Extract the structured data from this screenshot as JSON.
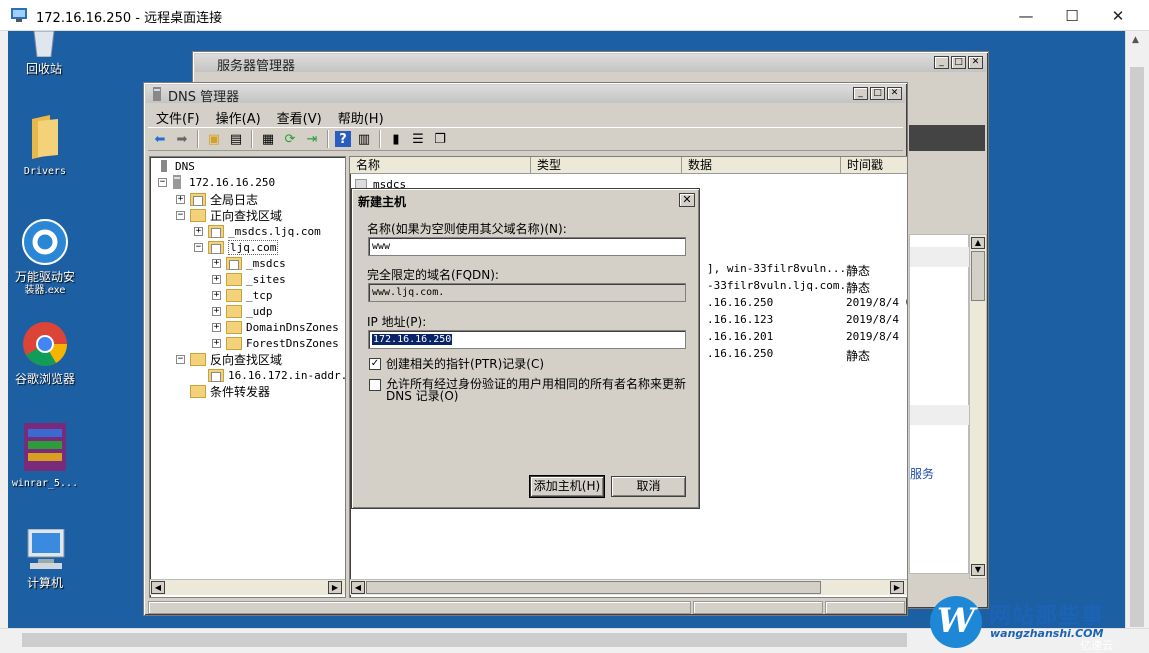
{
  "rdp": {
    "title": "172.16.16.250 - 远程桌面连接",
    "minimize": "—",
    "maximize": "☐",
    "close": "✕"
  },
  "desktop_icons": {
    "recycle": "回收站",
    "drivers": "Drivers",
    "driver_wizard_1": "万能驱动安",
    "driver_wizard_2": "装器.exe",
    "chrome": "谷歌浏览器",
    "winrar": "winrar_5...",
    "computer": "计算机"
  },
  "server_manager": {
    "title": "服务器管理器",
    "link": "服务"
  },
  "dns": {
    "title": "DNS 管理器",
    "menu": [
      "文件(F)",
      "操作(A)",
      "查看(V)",
      "帮助(H)"
    ],
    "tree": {
      "root": "DNS",
      "server": "172.16.16.250",
      "global_logs": "全局日志",
      "forward_zones": "正向查找区域",
      "msdcs_zone": "_msdcs.ljq.com",
      "ljq_zone": "ljq.com",
      "children": [
        "_msdcs",
        "_sites",
        "_tcp",
        "_udp",
        "DomainDnsZones",
        "ForestDnsZones"
      ],
      "reverse_zones": "反向查找区域",
      "reverse_zone": "16.16.172.in-addr.arpa",
      "forwarders": "条件转发器"
    },
    "columns": [
      "名称",
      "类型",
      "数据",
      "时间戳"
    ],
    "first_record": "msdcs",
    "records": [
      {
        "data": "], win-33filr8vuln...",
        "time": "静态"
      },
      {
        "data": "-33filr8vuln.ljq.com.",
        "time": "静态"
      },
      {
        "data": ".16.16.250",
        "time": "2019/8/4 0"
      },
      {
        "data": ".16.16.123",
        "time": "2019/8/4 1"
      },
      {
        "data": ".16.16.201",
        "time": "2019/8/4 1"
      },
      {
        "data": ".16.16.250",
        "time": "静态"
      }
    ]
  },
  "dialog": {
    "title": "新建主机",
    "close": "✕",
    "name_label": "名称(如果为空则使用其父域名称)(N):",
    "name_value": "www",
    "fqdn_label": "完全限定的域名(FQDN):",
    "fqdn_value": "www.ljq.com.",
    "ip_label": "IP 地址(P):",
    "ip_value": "172.16.16.250",
    "ptr_label": "创建相关的指针(PTR)记录(C)",
    "ptr_checked": "✓",
    "allow_label_1": "允许所有经过身份验证的用户用相同的所有者名称来更新",
    "allow_label_2": "DNS 记录(O)",
    "add_button": "添加主机(H)",
    "cancel_button": "取消"
  },
  "watermark": {
    "logo": "W",
    "cn": "网站那些事",
    "en": "wangzhanshi.COM",
    "sub": "亿速云"
  }
}
